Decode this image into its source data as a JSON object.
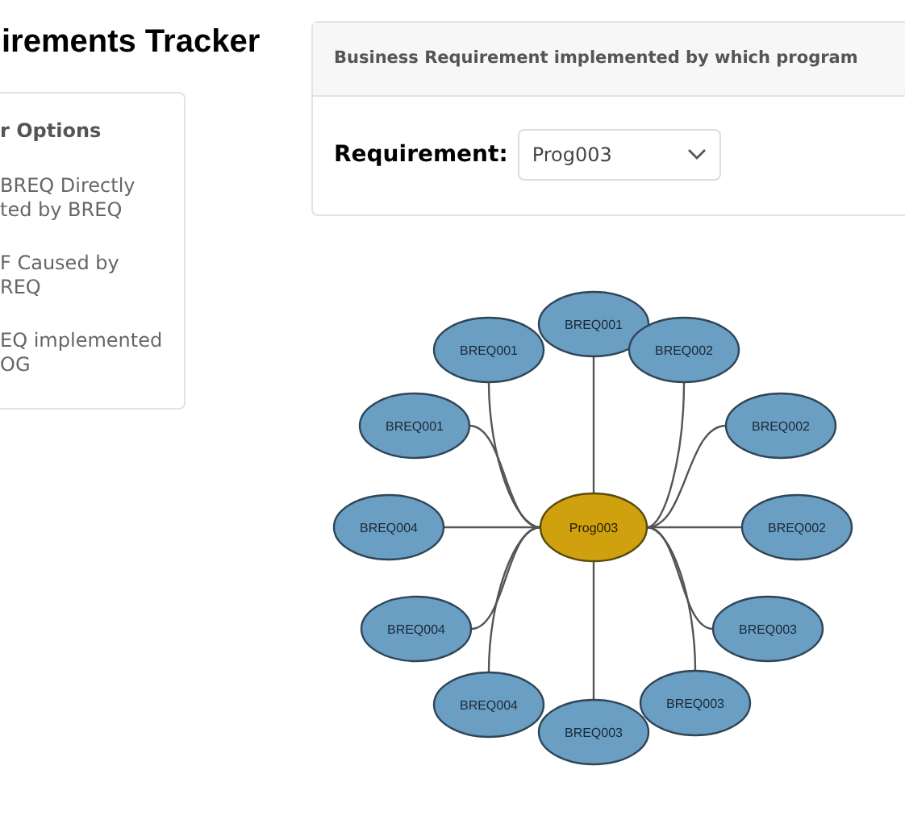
{
  "title": "irements Tracker",
  "options_panel": {
    "heading": "r Options",
    "items": [
      {
        "lines": [
          "BREQ Directly",
          "ted by BREQ"
        ]
      },
      {
        "lines": [
          "F Caused by",
          "REQ"
        ]
      },
      {
        "lines": [
          "EQ implemented",
          "OG"
        ]
      }
    ]
  },
  "requirement_panel": {
    "header": "Business Requirement implemented by which program",
    "label": "Requirement:",
    "select_value": "Prog003"
  },
  "diagram": {
    "center": "Prog003",
    "nodes": [
      "BREQ001",
      "BREQ001",
      "BREQ002",
      "BREQ001",
      "BREQ002",
      "BREQ004",
      "BREQ002",
      "BREQ004",
      "BREQ003",
      "BREQ004",
      "BREQ003",
      "BREQ003"
    ]
  }
}
